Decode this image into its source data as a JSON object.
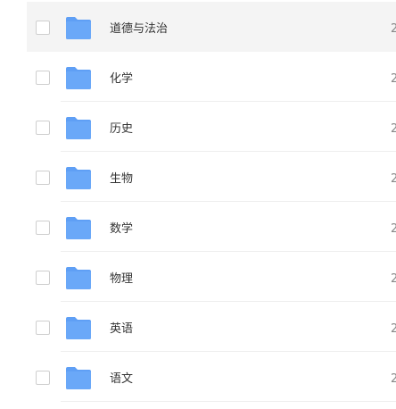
{
  "colors": {
    "folder": "#6aa8f8",
    "folder_tab": "#5f9ff5",
    "hover_row": "#f4f4f4"
  },
  "file_list": {
    "rows": [
      {
        "name": "道德与法治",
        "meta": "2",
        "icon": "folder-icon",
        "hovered": true
      },
      {
        "name": "化学",
        "meta": "2",
        "icon": "folder-icon"
      },
      {
        "name": "历史",
        "meta": "2",
        "icon": "folder-icon"
      },
      {
        "name": "生物",
        "meta": "2",
        "icon": "folder-icon"
      },
      {
        "name": "数学",
        "meta": "2",
        "icon": "folder-icon"
      },
      {
        "name": "物理",
        "meta": "2",
        "icon": "folder-icon"
      },
      {
        "name": "英语",
        "meta": "2",
        "icon": "folder-icon"
      },
      {
        "name": "语文",
        "meta": "2",
        "icon": "folder-icon"
      }
    ]
  }
}
